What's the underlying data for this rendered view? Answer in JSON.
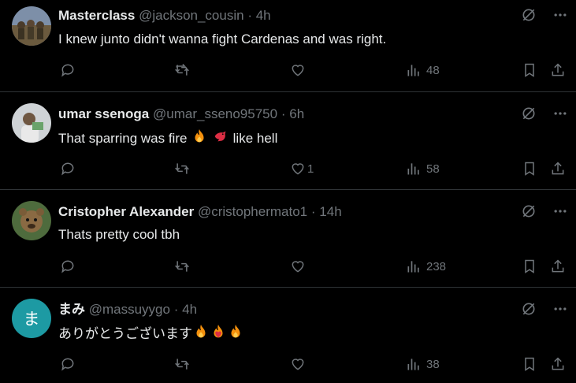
{
  "colors": {
    "background": "#000000",
    "primary_text": "#e7e9ea",
    "secondary_text": "#71767b",
    "divider": "#2f3336",
    "letter_avatar": "#1d9aa3"
  },
  "tweets": [
    {
      "name": "Masterclass",
      "handle": "@jackson_cousin",
      "dot": "·",
      "time": "4h",
      "text": "I knew junto didn't wanna fight Cardenas and was right.",
      "replies": "",
      "reposts": "",
      "likes": "",
      "views": "48",
      "avatar_icon": "group-photo-avatar"
    },
    {
      "name": "umar ssenoga",
      "handle": "@umar_sseno95750",
      "dot": "·",
      "time": "6h",
      "text": "That sparring was fire",
      "text_after": "like hell",
      "emojis": [
        "fire-emoji",
        "bird-emoji"
      ],
      "replies": "",
      "reposts": "",
      "likes": "1",
      "views": "58",
      "avatar_icon": "person-photo-avatar"
    },
    {
      "name": "Cristopher Alexander",
      "handle": "@cristophermato1",
      "dot": "·",
      "time": "14h",
      "text": "Thats pretty cool tbh",
      "replies": "",
      "reposts": "",
      "likes": "",
      "views": "238",
      "avatar_icon": "animal-photo-avatar"
    },
    {
      "name": "まみ",
      "handle": "@massuyygo",
      "dot": "·",
      "time": "4h",
      "text": "ありがとうございます",
      "emojis": [
        "fire-emoji",
        "fire-heart-emoji",
        "fire-emoji"
      ],
      "replies": "",
      "reposts": "",
      "likes": "",
      "views": "38",
      "avatar_letter": "ま"
    }
  ]
}
